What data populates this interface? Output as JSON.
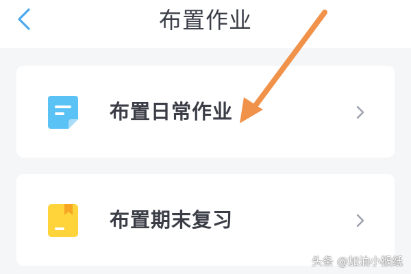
{
  "header": {
    "title": "布置作业",
    "back_icon": "chevron-left-icon"
  },
  "colors": {
    "accent_blue": "#4aa8f0",
    "note_icon_blue": "#5bc2f5",
    "book_icon_yellow": "#ffd43b",
    "book_tab_orange": "#f6a623",
    "arrow_orange": "#f0924a",
    "chevron_gray": "#9aa0ab"
  },
  "menu": {
    "items": [
      {
        "label": "布置日常作业",
        "icon": "note-icon"
      },
      {
        "label": "布置期末复习",
        "icon": "book-icon"
      }
    ]
  },
  "watermark": "头条 @加油小猴纸"
}
